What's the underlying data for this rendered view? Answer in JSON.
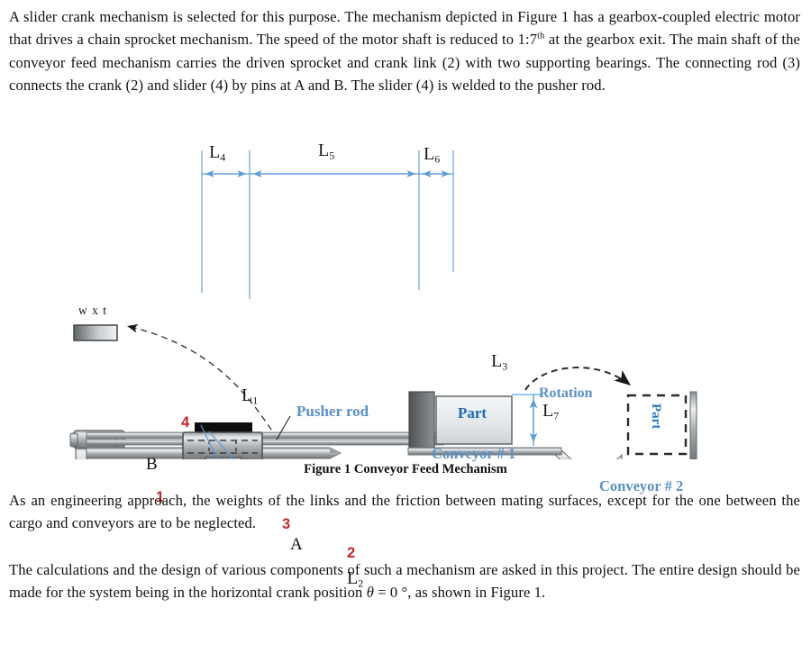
{
  "document": {
    "paragraphs": {
      "intro_a": "A slider crank mechanism is selected for this purpose. The mechanism depicted in Figure 1 has a gearbox-coupled electric motor that drives a chain sprocket mechanism. The speed of the motor shaft is reduced to 1:7",
      "intro_sup": "th",
      "intro_b": " at the gearbox exit. The main shaft of the conveyor feed mechanism carries the driven sprocket and crank link (2) with two supporting bearings. The connecting rod (3) connects the crank (2) and slider (4) by pins at A and B. The slider (4) is welded to the pusher rod.",
      "approach": "As an engineering approach, the weights of the links and the friction between mating surfaces, except for the one between the cargo and conveyors are to be neglected.",
      "calc_a": "The calculations and the design of various components of such a mechanism are asked in this project. The entire design should be made for the system being in the horizontal crank position ",
      "calc_theta": "θ",
      "calc_b": " = 0 °, as shown in Figure 1."
    },
    "caption": "Figure 1 Conveyor Feed Mechanism"
  },
  "figure": {
    "dimensions": {
      "l1_base": "L",
      "l1_sub": "1",
      "l2_base": "L",
      "l2_sub": "2",
      "l3_base": "L",
      "l3_sub": "3",
      "l4_base": "L",
      "l4_sub": "4",
      "l5_base": "L",
      "l5_sub": "5",
      "l6_base": "L",
      "l6_sub": "6",
      "l7_base": "L",
      "l7_sub": "7"
    },
    "section_label": "w x t",
    "joints": {
      "a": "A",
      "b": "B"
    },
    "links": {
      "ground": "1",
      "crank": "2",
      "rod": "3",
      "slider": "4"
    },
    "annotations": {
      "pusher_rod": "Pusher rod",
      "part_on_conveyor1": "Part",
      "part_rotated": "Part",
      "rotation": "Rotation",
      "conveyor1": "Conveyor # 1",
      "conveyor2": "Conveyor # 2"
    },
    "colors": {
      "dimension_blue": "#5b9bd5",
      "label_blue": "#5b90c4",
      "part_text_blue": "#1f6bb0",
      "link_number_red": "#c1272d",
      "metal_dark": "#6f7275",
      "metal_light": "#d7dbdd",
      "text_black": "#111111"
    }
  }
}
